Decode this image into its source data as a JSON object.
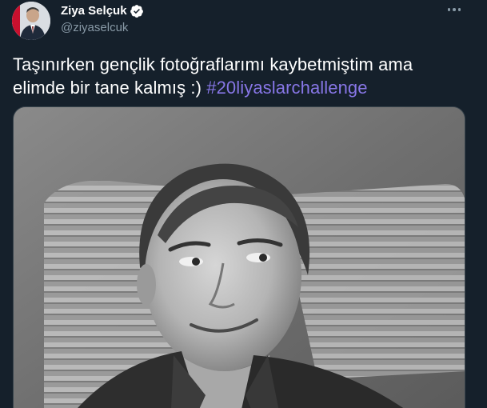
{
  "author": {
    "display_name": "Ziya Selçuk",
    "handle": "@ziyaselcuk",
    "verified": true
  },
  "tweet": {
    "text_before_hashtag": "Taşınırken gençlik fotoğraflarımı kaybetmiştim ama elimde bir tane kalmış :) ",
    "hashtag": "#20liyaslarchallenge"
  },
  "icons": {
    "verified": "verified-badge-icon",
    "more": "more-options-icon"
  },
  "colors": {
    "background": "#15202b",
    "text": "#ffffff",
    "secondary_text": "#8899a6",
    "hashtag": "#8776e6",
    "verified_badge": "#ffffff"
  }
}
